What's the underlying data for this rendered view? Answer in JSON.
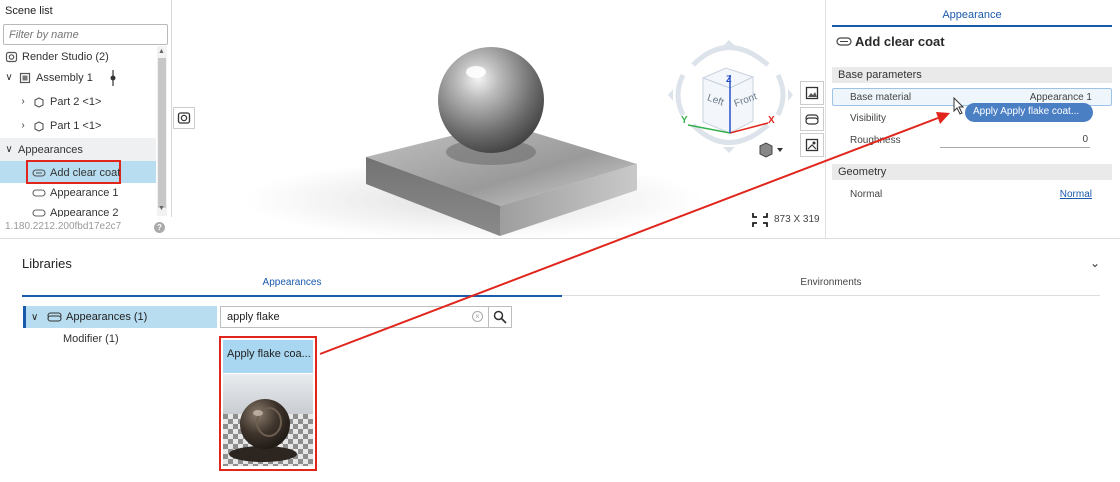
{
  "scene_list": {
    "title": "Scene list",
    "filter_placeholder": "Filter by name",
    "items": [
      {
        "label": "Render Studio (2)"
      },
      {
        "label": "Assembly 1"
      },
      {
        "label": "Part 2 <1>"
      },
      {
        "label": "Part 1 <1>"
      },
      {
        "label": "Appearances"
      },
      {
        "label": "Add clear coat"
      },
      {
        "label": "Appearance 1"
      },
      {
        "label": "Appearance 2"
      }
    ],
    "version": "1.180.2212.200fbd17e2c7",
    "help": "?"
  },
  "viewport": {
    "view_cube": {
      "left": "Left",
      "front": "Front",
      "z": "Z",
      "x": "X",
      "y": "Y"
    },
    "dimensions": "873 X 319"
  },
  "appearance_panel": {
    "tab": "Appearance",
    "title": "Add clear coat",
    "base_parameters": {
      "header": "Base parameters",
      "base_material_label": "Base material",
      "base_material_value": "Appearance 1",
      "visibility_label": "Visibility",
      "roughness_label": "Roughness",
      "roughness_value": "0"
    },
    "geometry": {
      "header": "Geometry",
      "normal_label": "Normal",
      "normal_value": "Normal"
    },
    "drag_tooltip": "Apply Apply flake coat..."
  },
  "libraries": {
    "title": "Libraries",
    "tabs": [
      "Appearances",
      "Environments"
    ],
    "tree": {
      "selected": "Appearances (1)",
      "child": "Modifier (1)"
    },
    "search_value": "apply flake",
    "card_title": "Apply flake coa..."
  },
  "colors": {
    "accent": "#1a5aab",
    "highlight": "#b8dcf0",
    "annotation": "#e0261c"
  }
}
